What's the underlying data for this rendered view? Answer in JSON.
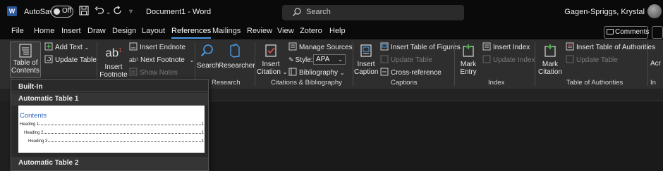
{
  "titlebar": {
    "app_icon_letter": "W",
    "autosave_label": "AutoSave",
    "autosave_state": "Off",
    "document_title": "Document1  -  Word",
    "search_placeholder": "Search",
    "user_name": "Gagen-Spriggs, Krystal"
  },
  "menu": {
    "tabs": [
      "File",
      "Home",
      "Insert",
      "Draw",
      "Design",
      "Layout",
      "References",
      "Mailings",
      "Review",
      "View",
      "Zotero",
      "Help"
    ],
    "active_tab": "References",
    "comments_label": "Comments"
  },
  "ribbon": {
    "toc": {
      "button_line1": "Table of",
      "button_line2": "Contents",
      "add_text": "Add Text",
      "update_table": "Update Table"
    },
    "footnotes": {
      "insert_footnote_line1": "Insert",
      "insert_footnote_line2": "Footnote",
      "insert_endnote": "Insert Endnote",
      "next_footnote": "Next Footnote",
      "show_notes": "Show Notes"
    },
    "research": {
      "search": "Search",
      "researcher": "Researcher",
      "group_label": "Research"
    },
    "citations": {
      "insert_citation_line1": "Insert",
      "insert_citation_line2": "Citation",
      "manage_sources": "Manage Sources",
      "style_label": "Style:",
      "style_value": "APA",
      "bibliography": "Bibliography",
      "group_label": "Citations & Bibliography"
    },
    "captions": {
      "insert_caption_line1": "Insert",
      "insert_caption_line2": "Caption",
      "insert_table_of_figures": "Insert Table of Figures",
      "update_table": "Update Table",
      "cross_reference": "Cross-reference",
      "group_label": "Captions"
    },
    "index": {
      "mark_entry_line1": "Mark",
      "mark_entry_line2": "Entry",
      "insert_index": "Insert Index",
      "update_index": "Update Index",
      "group_label": "Index"
    },
    "authorities": {
      "mark_citation_line1": "Mark",
      "mark_citation_line2": "Citation",
      "insert_table_of_authorities": "Insert Table of Authorities",
      "update_table": "Update Table",
      "group_label": "Table of Authorities"
    },
    "cut_off_group": {
      "group_label": "In",
      "button_label": "Acr"
    }
  },
  "toc_dropdown": {
    "section_label": "Built-In",
    "option1_title": "Automatic Table 1",
    "option2_title": "Automatic Table 2",
    "preview": {
      "title": "Contents",
      "entries": [
        {
          "label": "Heading 1",
          "page": "1"
        },
        {
          "label": "Heading 2",
          "page": "1"
        },
        {
          "label": "Heading 3",
          "page": "1"
        }
      ]
    }
  },
  "colors": {
    "accent": "#4a9ce6",
    "titlebar_bg": "#0a0a0a",
    "ribbon_bg": "#2e2e2e",
    "preview_heading": "#2e63b5"
  }
}
